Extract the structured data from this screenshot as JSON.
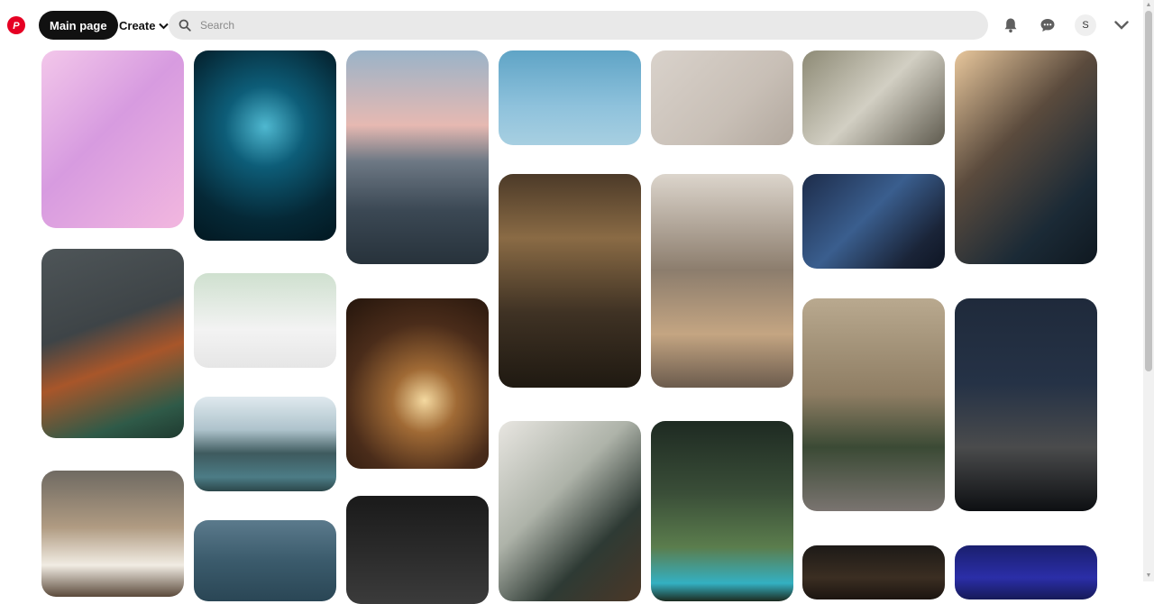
{
  "header": {
    "main_page_label": "Main page",
    "create_label": "Create",
    "search_placeholder": "Search",
    "avatar_initial": "S",
    "brand_color": "#e60023"
  },
  "icons": {
    "logo": "pinterest-logo-icon",
    "search": "search-icon",
    "notifications": "bell-icon",
    "messages": "chat-bubble-icon",
    "menu": "chevron-down-icon"
  },
  "pins": [
    {
      "name": "pin-pink-abstract-3d",
      "bg": "linear-gradient(135deg,#f3c7ea 0%,#d79be0 45%,#f2b7df 100%)"
    },
    {
      "name": "pin-arctic-iceberg",
      "bg": "radial-gradient(circle at 50% 40%,#4fb8d0 0%,#0d5d78 30%,#052836 70%,#021821 100%)"
    },
    {
      "name": "pin-sunset-shoreline",
      "bg": "linear-gradient(180deg,#9ab3c8 0%,#e6b9b2 35%,#6d7884 52%,#3b4854 75%,#27323b 100%)"
    },
    {
      "name": "pin-red-lanterns-sky",
      "bg": "linear-gradient(180deg,#5fa4c6 0%,#8fc2dc 60%,#a7cfe1 100%)"
    },
    {
      "name": "pin-christmas-decor-flatlay",
      "bg": "linear-gradient(135deg,#d9d2cb 0%,#c8bfb6 60%,#b2a89e 100%)"
    },
    {
      "name": "pin-home-office-desk",
      "bg": "linear-gradient(135deg,#8d8a75 0%,#d2cfc3 50%,#5e5a4e 100%)"
    },
    {
      "name": "pin-table-lamp-wine",
      "bg": "linear-gradient(135deg,#e8c79c 0%,#5b4b3d 40%,#1b2a36 75%,#0f1820 100%)"
    },
    {
      "name": "pin-modern-building",
      "bg": "linear-gradient(160deg,#4e5558 0%,#3e4447 40%,#a8562a 60%,#2f5a48 85%,#1f3a30 100%)"
    },
    {
      "name": "pin-bright-workspace",
      "bg": "linear-gradient(180deg,#cfe0cf 0%,#f3f3f3 60%,#e6e6e6 100%)"
    },
    {
      "name": "pin-christmas-house-candle",
      "bg": "radial-gradient(circle at 55% 60%,#f4d9a0 0%,#a06a35 25%,#4a2c1a 60%,#24150c 100%)"
    },
    {
      "name": "pin-fairy-lights-woman",
      "bg": "linear-gradient(180deg,#4c3a28 0%,#8a6b45 30%,#3f3224 65%,#1f1911 100%)"
    },
    {
      "name": "pin-cafe-woman-shelves",
      "bg": "linear-gradient(180deg,#dcd5cc 0%,#8c7d6d 45%,#c4a582 75%,#6b5b4d 100%)"
    },
    {
      "name": "pin-subway-tunnel",
      "bg": "linear-gradient(135deg,#1d2c4a 0%,#3a5e8e 45%,#1a2438 80%,#0e1523 100%)"
    },
    {
      "name": "pin-mountain-lake",
      "bg": "linear-gradient(180deg,#dfe9ee 0%,#aec3cc 35%,#3e5a5e 60%,#4c7c86 85%,#2c474a 100%)"
    },
    {
      "name": "pin-old-building-street",
      "bg": "linear-gradient(180deg,#b9a98f 0%,#8e7d63 45%,#3b4a35 70%,#7a7470 100%)"
    },
    {
      "name": "pin-city-skyline-night",
      "bg": "linear-gradient(180deg,#1f2a3b 0%,#253246 40%,#4a4b4c 70%,#0d0f12 100%)"
    },
    {
      "name": "pin-breakfast-plate",
      "bg": "linear-gradient(180deg,#6f6a62 0%,#b09b82 45%,#f1ece3 75%,#5b4a3b 100%)"
    },
    {
      "name": "pin-piano-hands",
      "bg": "linear-gradient(180deg,#1a1a1a 0%,#2a2a2a 50%,#3b3b3b 100%)"
    },
    {
      "name": "pin-living-room-plant",
      "bg": "linear-gradient(135deg,#e8e6e1 0%,#aeb3a9 40%,#2e3a34 70%,#4b3727 100%)"
    },
    {
      "name": "pin-green-valley-lake",
      "bg": "linear-gradient(180deg,#1e2a22 0%,#3a4e38 40%,#5b7d4d 70%,#34b0c2 90%,#1c2b20 100%)"
    },
    {
      "name": "pin-ocean-mast",
      "bg": "linear-gradient(180deg,#5b7a8c 0%,#3b5b6c 50%,#2a4655 100%)"
    },
    {
      "name": "pin-dark-warm-interior",
      "bg": "linear-gradient(180deg,#1d1a17 0%,#3b2e22 60%,#1b1410 100%)"
    },
    {
      "name": "pin-deep-blue-gradient",
      "bg": "linear-gradient(180deg,#1a1f6e 0%,#2b2ea8 60%,#161a58 100%)"
    }
  ]
}
